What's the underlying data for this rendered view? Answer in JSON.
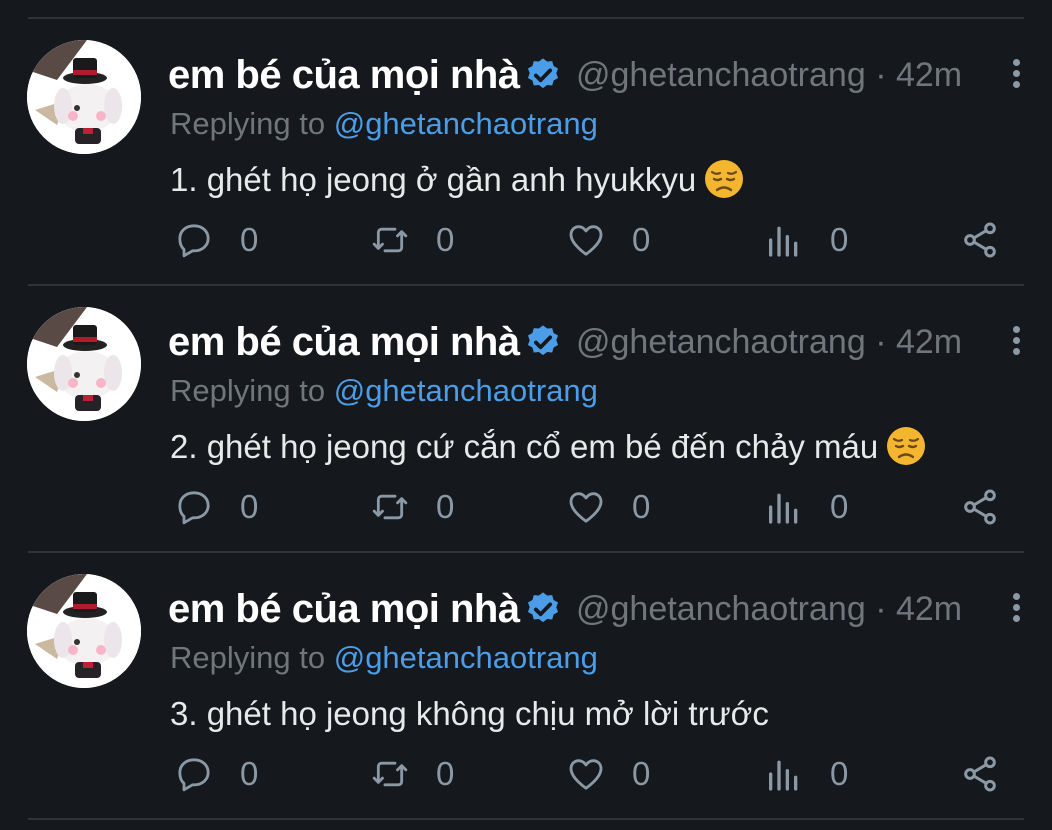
{
  "tweets": [
    {
      "name": "em bé của mọi nhà",
      "handle": "@ghetanchaotrang",
      "time": "· 42m",
      "replying_label": "Replying to",
      "replying_to": "@ghetanchaotrang",
      "text": "1. ghét họ jeong ở gần anh hyukkyu",
      "emoji": "disappointed-face",
      "replies": "0",
      "retweets": "0",
      "likes": "0",
      "views": "0"
    },
    {
      "name": "em bé của mọi nhà",
      "handle": "@ghetanchaotrang",
      "time": "· 42m",
      "replying_label": "Replying to",
      "replying_to": "@ghetanchaotrang",
      "text": "2. ghét họ jeong cứ cắn cổ em bé đến chảy máu",
      "emoji": "disappointed-face",
      "replies": "0",
      "retweets": "0",
      "likes": "0",
      "views": "0"
    },
    {
      "name": "em bé của mọi nhà",
      "handle": "@ghetanchaotrang",
      "time": "· 42m",
      "replying_label": "Replying to",
      "replying_to": "@ghetanchaotrang",
      "text": "3. ghét họ jeong không chịu mở lời trước",
      "emoji": null,
      "replies": "0",
      "retweets": "0",
      "likes": "0",
      "views": "0"
    }
  ],
  "colors": {
    "background": "#15181c",
    "divider": "#2f3336",
    "muted": "#71767b",
    "link": "#4c9de8",
    "verified": "#4c9de8"
  }
}
